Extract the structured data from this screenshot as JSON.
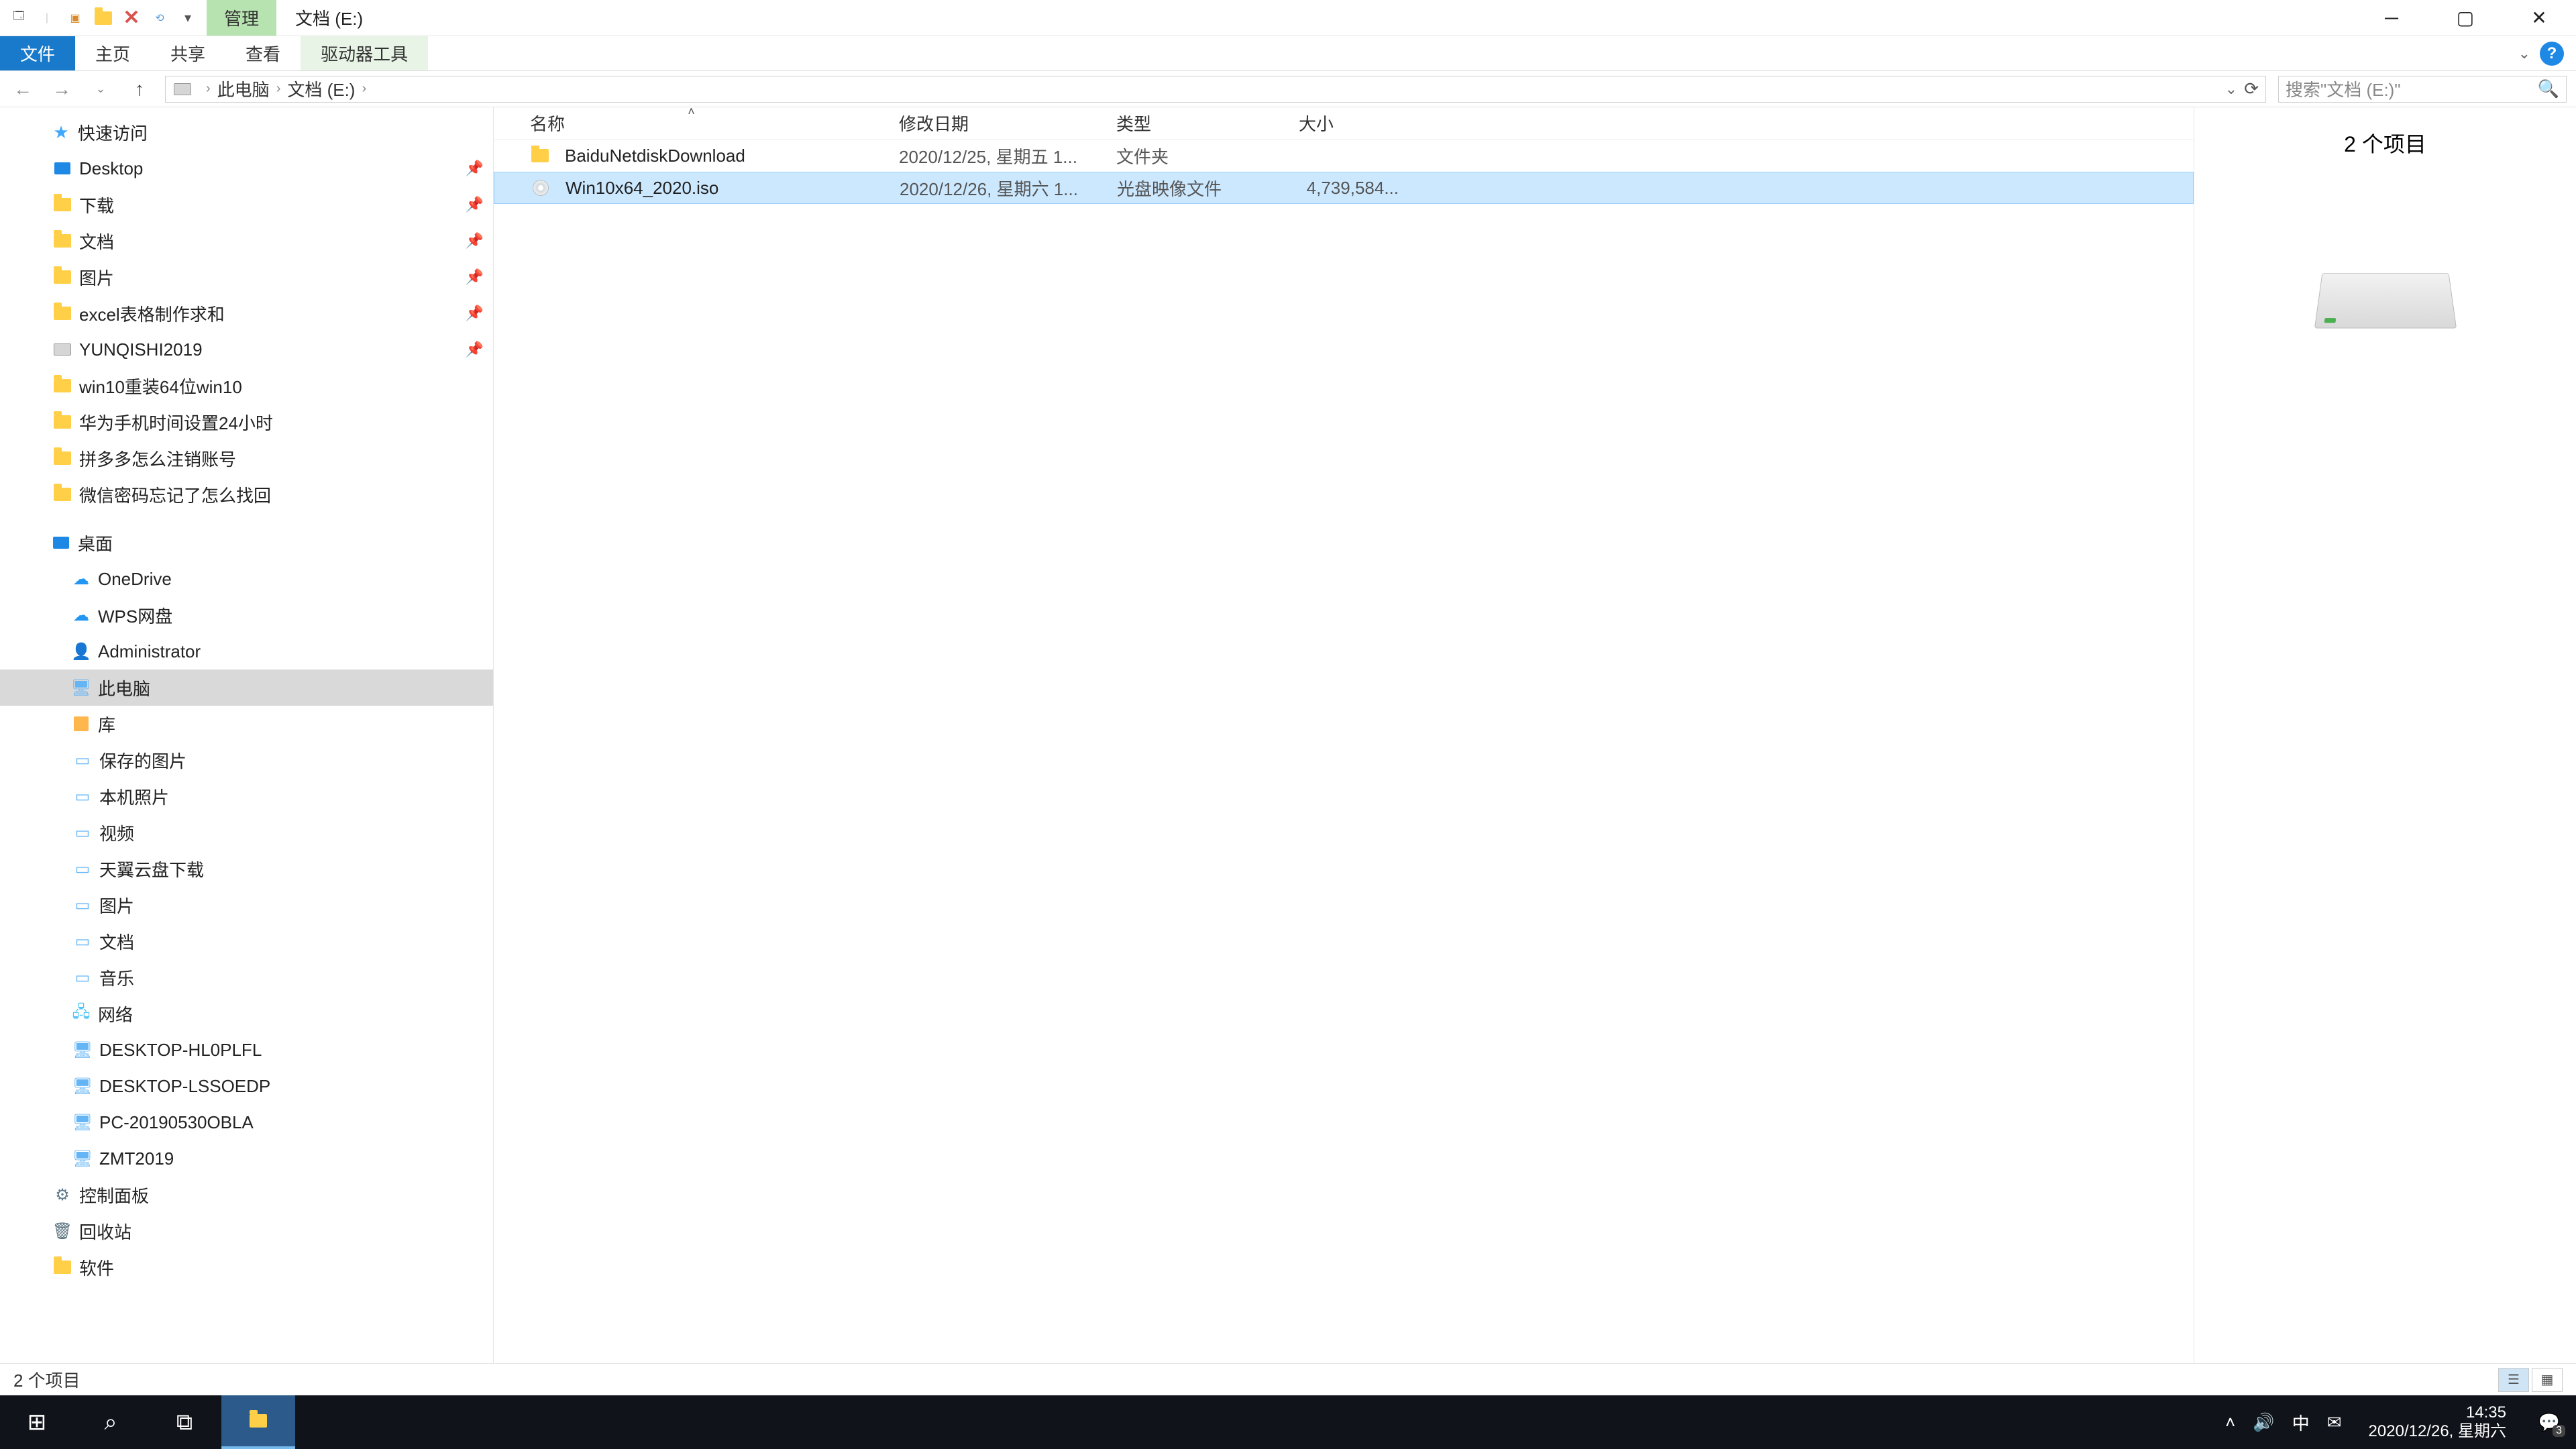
{
  "title_bar": {
    "context_tab": "管理",
    "title": "文档 (E:)"
  },
  "ribbon": {
    "file": "文件",
    "tabs": [
      "主页",
      "共享",
      "查看"
    ],
    "contextual": "驱动器工具"
  },
  "address": {
    "crumbs": [
      "此电脑",
      "文档 (E:)"
    ],
    "search_placeholder": "搜索\"文档 (E:)\""
  },
  "nav": {
    "quick_access": "快速访问",
    "quick_items": [
      {
        "label": "Desktop",
        "pinned": true,
        "icon": "desktop"
      },
      {
        "label": "下载",
        "pinned": true,
        "icon": "folder"
      },
      {
        "label": "文档",
        "pinned": true,
        "icon": "folder"
      },
      {
        "label": "图片",
        "pinned": true,
        "icon": "folder"
      },
      {
        "label": "excel表格制作求和",
        "pinned": true,
        "icon": "folder"
      },
      {
        "label": "YUNQISHI2019",
        "pinned": true,
        "icon": "drive"
      },
      {
        "label": "win10重装64位win10",
        "pinned": false,
        "icon": "folder"
      },
      {
        "label": "华为手机时间设置24小时",
        "pinned": false,
        "icon": "folder"
      },
      {
        "label": "拼多多怎么注销账号",
        "pinned": false,
        "icon": "folder"
      },
      {
        "label": "微信密码忘记了怎么找回",
        "pinned": false,
        "icon": "folder"
      }
    ],
    "desktop": "桌面",
    "desktop_items": [
      {
        "label": "OneDrive",
        "icon": "cloud"
      },
      {
        "label": "WPS网盘",
        "icon": "cloud"
      },
      {
        "label": "Administrator",
        "icon": "user"
      },
      {
        "label": "此电脑",
        "icon": "pc",
        "selected": true
      },
      {
        "label": "库",
        "icon": "lib"
      }
    ],
    "lib_items": [
      {
        "label": "保存的图片"
      },
      {
        "label": "本机照片"
      },
      {
        "label": "视频"
      },
      {
        "label": "天翼云盘下载"
      },
      {
        "label": "图片"
      },
      {
        "label": "文档"
      },
      {
        "label": "音乐"
      }
    ],
    "network": "网络",
    "network_items": [
      {
        "label": "DESKTOP-HL0PLFL"
      },
      {
        "label": "DESKTOP-LSSOEDP"
      },
      {
        "label": "PC-20190530OBLA"
      },
      {
        "label": "ZMT2019"
      }
    ],
    "extras": [
      {
        "label": "控制面板",
        "icon": "ctrl"
      },
      {
        "label": "回收站",
        "icon": "recycle"
      },
      {
        "label": "软件",
        "icon": "folder"
      }
    ]
  },
  "columns": {
    "name": "名称",
    "date": "修改日期",
    "type": "类型",
    "size": "大小"
  },
  "files": [
    {
      "name": "BaiduNetdiskDownload",
      "date": "2020/12/25, 星期五 1...",
      "type": "文件夹",
      "size": "",
      "icon": "folder",
      "selected": false
    },
    {
      "name": "Win10x64_2020.iso",
      "date": "2020/12/26, 星期六 1...",
      "type": "光盘映像文件",
      "size": "4,739,584...",
      "icon": "disc",
      "selected": true
    }
  ],
  "preview": {
    "heading": "2 个项目"
  },
  "status": {
    "text": "2 个项目"
  },
  "taskbar": {
    "time": "14:35",
    "date": "2020/12/26, 星期六",
    "ime": "中",
    "notif_count": "3"
  }
}
